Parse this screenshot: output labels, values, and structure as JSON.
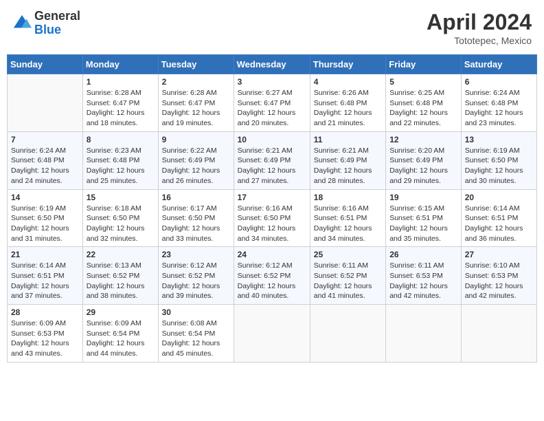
{
  "logo": {
    "general": "General",
    "blue": "Blue"
  },
  "header": {
    "month": "April 2024",
    "location": "Tototepec, Mexico"
  },
  "weekdays": [
    "Sunday",
    "Monday",
    "Tuesday",
    "Wednesday",
    "Thursday",
    "Friday",
    "Saturday"
  ],
  "weeks": [
    [
      {
        "day": "",
        "sunrise": "",
        "sunset": "",
        "daylight": ""
      },
      {
        "day": "1",
        "sunrise": "Sunrise: 6:28 AM",
        "sunset": "Sunset: 6:47 PM",
        "daylight": "Daylight: 12 hours and 18 minutes."
      },
      {
        "day": "2",
        "sunrise": "Sunrise: 6:28 AM",
        "sunset": "Sunset: 6:47 PM",
        "daylight": "Daylight: 12 hours and 19 minutes."
      },
      {
        "day": "3",
        "sunrise": "Sunrise: 6:27 AM",
        "sunset": "Sunset: 6:47 PM",
        "daylight": "Daylight: 12 hours and 20 minutes."
      },
      {
        "day": "4",
        "sunrise": "Sunrise: 6:26 AM",
        "sunset": "Sunset: 6:48 PM",
        "daylight": "Daylight: 12 hours and 21 minutes."
      },
      {
        "day": "5",
        "sunrise": "Sunrise: 6:25 AM",
        "sunset": "Sunset: 6:48 PM",
        "daylight": "Daylight: 12 hours and 22 minutes."
      },
      {
        "day": "6",
        "sunrise": "Sunrise: 6:24 AM",
        "sunset": "Sunset: 6:48 PM",
        "daylight": "Daylight: 12 hours and 23 minutes."
      }
    ],
    [
      {
        "day": "7",
        "sunrise": "Sunrise: 6:24 AM",
        "sunset": "Sunset: 6:48 PM",
        "daylight": "Daylight: 12 hours and 24 minutes."
      },
      {
        "day": "8",
        "sunrise": "Sunrise: 6:23 AM",
        "sunset": "Sunset: 6:48 PM",
        "daylight": "Daylight: 12 hours and 25 minutes."
      },
      {
        "day": "9",
        "sunrise": "Sunrise: 6:22 AM",
        "sunset": "Sunset: 6:49 PM",
        "daylight": "Daylight: 12 hours and 26 minutes."
      },
      {
        "day": "10",
        "sunrise": "Sunrise: 6:21 AM",
        "sunset": "Sunset: 6:49 PM",
        "daylight": "Daylight: 12 hours and 27 minutes."
      },
      {
        "day": "11",
        "sunrise": "Sunrise: 6:21 AM",
        "sunset": "Sunset: 6:49 PM",
        "daylight": "Daylight: 12 hours and 28 minutes."
      },
      {
        "day": "12",
        "sunrise": "Sunrise: 6:20 AM",
        "sunset": "Sunset: 6:49 PM",
        "daylight": "Daylight: 12 hours and 29 minutes."
      },
      {
        "day": "13",
        "sunrise": "Sunrise: 6:19 AM",
        "sunset": "Sunset: 6:50 PM",
        "daylight": "Daylight: 12 hours and 30 minutes."
      }
    ],
    [
      {
        "day": "14",
        "sunrise": "Sunrise: 6:19 AM",
        "sunset": "Sunset: 6:50 PM",
        "daylight": "Daylight: 12 hours and 31 minutes."
      },
      {
        "day": "15",
        "sunrise": "Sunrise: 6:18 AM",
        "sunset": "Sunset: 6:50 PM",
        "daylight": "Daylight: 12 hours and 32 minutes."
      },
      {
        "day": "16",
        "sunrise": "Sunrise: 6:17 AM",
        "sunset": "Sunset: 6:50 PM",
        "daylight": "Daylight: 12 hours and 33 minutes."
      },
      {
        "day": "17",
        "sunrise": "Sunrise: 6:16 AM",
        "sunset": "Sunset: 6:50 PM",
        "daylight": "Daylight: 12 hours and 34 minutes."
      },
      {
        "day": "18",
        "sunrise": "Sunrise: 6:16 AM",
        "sunset": "Sunset: 6:51 PM",
        "daylight": "Daylight: 12 hours and 34 minutes."
      },
      {
        "day": "19",
        "sunrise": "Sunrise: 6:15 AM",
        "sunset": "Sunset: 6:51 PM",
        "daylight": "Daylight: 12 hours and 35 minutes."
      },
      {
        "day": "20",
        "sunrise": "Sunrise: 6:14 AM",
        "sunset": "Sunset: 6:51 PM",
        "daylight": "Daylight: 12 hours and 36 minutes."
      }
    ],
    [
      {
        "day": "21",
        "sunrise": "Sunrise: 6:14 AM",
        "sunset": "Sunset: 6:51 PM",
        "daylight": "Daylight: 12 hours and 37 minutes."
      },
      {
        "day": "22",
        "sunrise": "Sunrise: 6:13 AM",
        "sunset": "Sunset: 6:52 PM",
        "daylight": "Daylight: 12 hours and 38 minutes."
      },
      {
        "day": "23",
        "sunrise": "Sunrise: 6:12 AM",
        "sunset": "Sunset: 6:52 PM",
        "daylight": "Daylight: 12 hours and 39 minutes."
      },
      {
        "day": "24",
        "sunrise": "Sunrise: 6:12 AM",
        "sunset": "Sunset: 6:52 PM",
        "daylight": "Daylight: 12 hours and 40 minutes."
      },
      {
        "day": "25",
        "sunrise": "Sunrise: 6:11 AM",
        "sunset": "Sunset: 6:52 PM",
        "daylight": "Daylight: 12 hours and 41 minutes."
      },
      {
        "day": "26",
        "sunrise": "Sunrise: 6:11 AM",
        "sunset": "Sunset: 6:53 PM",
        "daylight": "Daylight: 12 hours and 42 minutes."
      },
      {
        "day": "27",
        "sunrise": "Sunrise: 6:10 AM",
        "sunset": "Sunset: 6:53 PM",
        "daylight": "Daylight: 12 hours and 42 minutes."
      }
    ],
    [
      {
        "day": "28",
        "sunrise": "Sunrise: 6:09 AM",
        "sunset": "Sunset: 6:53 PM",
        "daylight": "Daylight: 12 hours and 43 minutes."
      },
      {
        "day": "29",
        "sunrise": "Sunrise: 6:09 AM",
        "sunset": "Sunset: 6:54 PM",
        "daylight": "Daylight: 12 hours and 44 minutes."
      },
      {
        "day": "30",
        "sunrise": "Sunrise: 6:08 AM",
        "sunset": "Sunset: 6:54 PM",
        "daylight": "Daylight: 12 hours and 45 minutes."
      },
      {
        "day": "",
        "sunrise": "",
        "sunset": "",
        "daylight": ""
      },
      {
        "day": "",
        "sunrise": "",
        "sunset": "",
        "daylight": ""
      },
      {
        "day": "",
        "sunrise": "",
        "sunset": "",
        "daylight": ""
      },
      {
        "day": "",
        "sunrise": "",
        "sunset": "",
        "daylight": ""
      }
    ]
  ]
}
